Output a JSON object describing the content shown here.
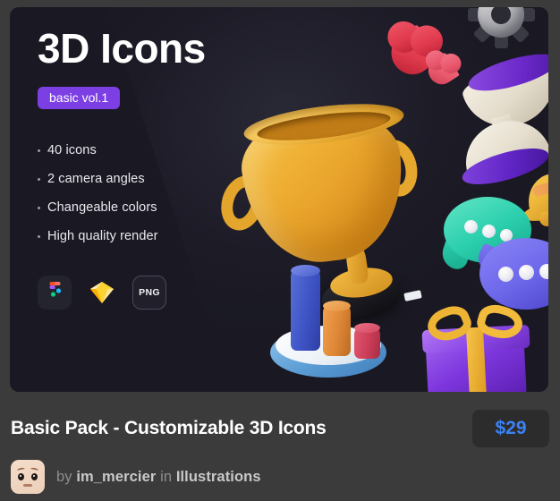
{
  "card": {
    "title": "3D Icons",
    "volume_badge": "basic vol.1",
    "features": [
      "40 icons",
      "2 camera angles",
      "Changeable colors",
      "High quality render"
    ],
    "formats": [
      {
        "name": "figma",
        "label": ""
      },
      {
        "name": "sketch",
        "label": ""
      },
      {
        "name": "png",
        "label": "PNG"
      }
    ],
    "colors": {
      "card_background": "#1a1923",
      "badge_purple": "#7c3fe4",
      "title_white": "#ffffff",
      "feature_text": "#e8e8ee"
    }
  },
  "footer": {
    "pack_title": "Basic Pack - Customizable 3D Icons",
    "price": "$29",
    "byline": {
      "by_label": "by",
      "author": "im_mercier",
      "in_label": "in",
      "category": "Illustrations"
    },
    "colors": {
      "page_background": "#3b3b3b",
      "price_text": "#3b82f6",
      "price_background": "#2c2c2c",
      "byline_muted": "#8d8d8d",
      "byline_strong": "#c9c9c9"
    }
  }
}
